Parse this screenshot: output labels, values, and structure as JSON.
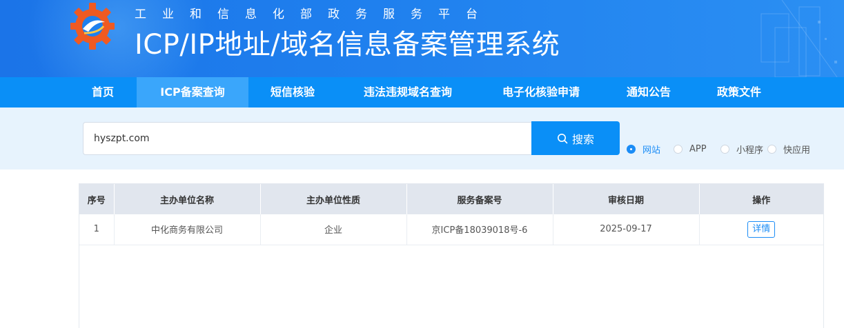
{
  "header": {
    "subtitle": "工业和信息化部政务服务平台",
    "title": "ICP/IP地址/域名信息备案管理系统"
  },
  "nav": {
    "items": [
      {
        "label": "首页"
      },
      {
        "label": "ICP备案查询",
        "active": true
      },
      {
        "label": "短信核验"
      },
      {
        "label": "违法违规域名查询"
      },
      {
        "label": "电子化核验申请"
      },
      {
        "label": "通知公告"
      },
      {
        "label": "政策文件"
      }
    ]
  },
  "search": {
    "value": "hyszpt.com",
    "button_label": "搜索",
    "options": [
      {
        "label": "网站",
        "checked": true
      },
      {
        "label": "APP"
      },
      {
        "label": "小程序"
      },
      {
        "label": "快应用"
      }
    ]
  },
  "table": {
    "headers": [
      "序号",
      "主办单位名称",
      "主办单位性质",
      "服务备案号",
      "审核日期",
      "操作"
    ],
    "rows": [
      {
        "index": "1",
        "name": "中化商务有限公司",
        "nature": "企业",
        "record_no": "京ICP备18039018号-6",
        "date": "2025-09-17",
        "action": "详情"
      }
    ]
  },
  "colors": {
    "banner": "#1f80ee",
    "nav": "#0a8ff7",
    "nav_active": "#3aa6fb",
    "search_bg": "#e7f3fd",
    "accent": "#1a8cf6",
    "table_header": "#e1e6ee"
  }
}
